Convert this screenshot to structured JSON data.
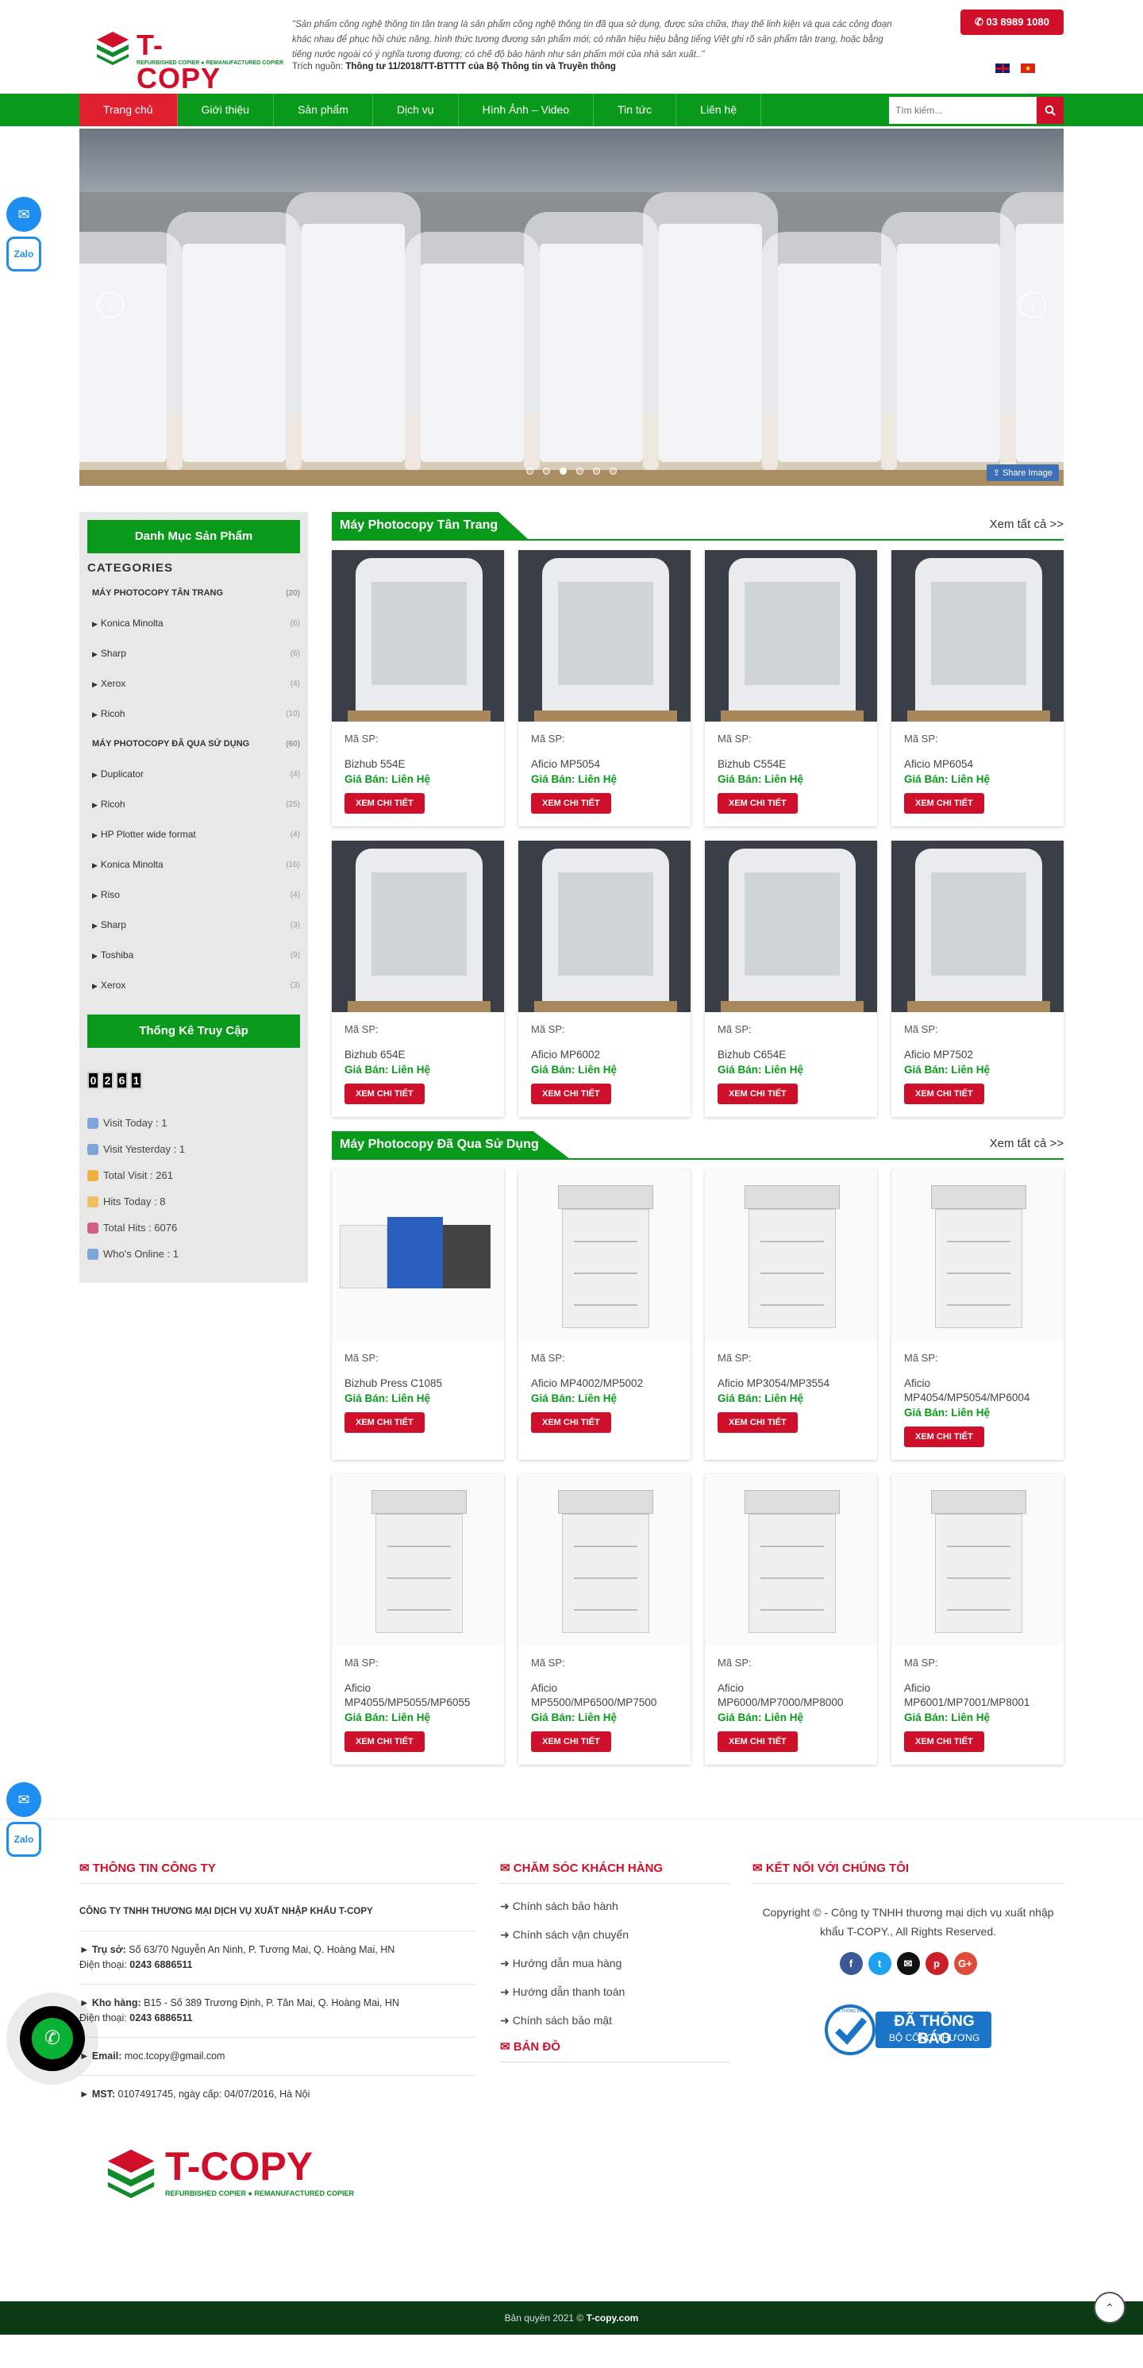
{
  "header": {
    "logo_text": "T-COPY",
    "logo_tagline": "REFURBISHED COPIER ● REMANUFACTURED COPIER",
    "quote": "\"Sản phẩm công nghệ thông tin tân trang là sản phẩm công nghệ thông tin đã qua sử dụng, được sửa chữa, thay thế linh kiện và qua các công đoạn khác nhau để phục hồi chức năng, hình thức tương đương sản phẩm mới; có nhãn hiệu hiệu bằng tiếng Việt ghi rõ sản phẩm tân trang, hoặc bằng tiếng nước ngoài có ý nghĩa tương đương; có chế độ bảo hành như sản phẩm mới của nhà sản xuất..\"",
    "source_label": "Trích nguồn:",
    "source_value": "Thông tư 11/2018/TT-BTTTT của Bộ Thông tin và Truyền thông",
    "hotline": "03 8989 1080"
  },
  "nav": {
    "items": [
      "Trang chủ",
      "Giới thiệu",
      "Sản phẩm",
      "Dịch vụ",
      "Hình Ảnh – Video",
      "Tin tức",
      "Liên hệ"
    ],
    "search_placeholder": "Tìm kiếm..."
  },
  "slider": {
    "share_label": "Share Image",
    "dot_count": 6,
    "active_dot": 3
  },
  "sidebar": {
    "category_title": "Danh Mục Sản Phẩm",
    "categories_head": "CATEGORIES",
    "categories": [
      {
        "label": "MÁY PHOTOCOPY TÂN TRANG",
        "count": "(20)",
        "top": true
      },
      {
        "label": "Konica Minolta",
        "count": "(6)"
      },
      {
        "label": "Sharp",
        "count": "(6)"
      },
      {
        "label": "Xerox",
        "count": "(4)"
      },
      {
        "label": "Ricoh",
        "count": "(10)"
      },
      {
        "label": "MÁY PHOTOCOPY ĐÃ QUA SỬ DỤNG",
        "count": "(60)",
        "top": true
      },
      {
        "label": "Duplicator",
        "count": "(4)"
      },
      {
        "label": "Ricoh",
        "count": "(25)"
      },
      {
        "label": "HP Plotter wide format",
        "count": "(4)"
      },
      {
        "label": "Konica Minolta",
        "count": "(16)"
      },
      {
        "label": "Riso",
        "count": "(4)"
      },
      {
        "label": "Sharp",
        "count": "(3)"
      },
      {
        "label": "Toshiba",
        "count": "(9)"
      },
      {
        "label": "Xerox",
        "count": "(3)"
      }
    ],
    "stats_title": "Thống Kê Truy Cập",
    "counter_digits": [
      "0",
      "2",
      "6",
      "1"
    ],
    "stats": [
      "Visit Today : 1",
      "Visit Yesterday : 1",
      "Total Visit : 261",
      "Hits Today : 8",
      "Total Hits : 6076",
      "Who's Online : 1"
    ]
  },
  "sections": [
    {
      "title": "Máy Photocopy Tân Trang",
      "see_all": "Xem tất cả >>",
      "products": [
        {
          "code_label": "Mã SP:",
          "name": "Bizhub 554E",
          "price": "Giá Bán: Liên Hệ",
          "button": "XEM CHI TIẾT"
        },
        {
          "code_label": "Mã SP:",
          "name": "Aficio MP5054",
          "price": "Giá Bán: Liên Hệ",
          "button": "XEM CHI TIẾT"
        },
        {
          "code_label": "Mã SP:",
          "name": "Bizhub C554E",
          "price": "Giá Bán: Liên Hệ",
          "button": "XEM CHI TIẾT"
        },
        {
          "code_label": "Mã SP:",
          "name": "Aficio MP6054",
          "price": "Giá Bán: Liên Hệ",
          "button": "XEM CHI TIẾT"
        },
        {
          "code_label": "Mã SP:",
          "name": "Bizhub 654E",
          "price": "Giá Bán: Liên Hệ",
          "button": "XEM CHI TIẾT"
        },
        {
          "code_label": "Mã SP:",
          "name": "Aficio MP6002",
          "price": "Giá Bán: Liên Hệ",
          "button": "XEM CHI TIẾT"
        },
        {
          "code_label": "Mã SP:",
          "name": "Bizhub C654E",
          "price": "Giá Bán: Liên Hệ",
          "button": "XEM CHI TIẾT"
        },
        {
          "code_label": "Mã SP:",
          "name": "Aficio MP7502",
          "price": "Giá Bán: Liên Hệ",
          "button": "XEM CHI TIẾT"
        }
      ]
    },
    {
      "title": "Máy Photocopy Đã Qua Sử Dụng",
      "see_all": "Xem tất cả >>",
      "products": [
        {
          "code_label": "Mã SP:",
          "name": "Bizhub Press C1085",
          "price": "Giá Bán: Liên Hệ",
          "button": "XEM CHI TIẾT"
        },
        {
          "code_label": "Mã SP:",
          "name": "Aficio MP4002/MP5002",
          "price": "Giá Bán: Liên Hệ",
          "button": "XEM CHI TIẾT"
        },
        {
          "code_label": "Mã SP:",
          "name": "Aficio MP3054/MP3554",
          "price": "Giá Bán: Liên Hệ",
          "button": "XEM CHI TIẾT"
        },
        {
          "code_label": "Mã SP:",
          "name": "Aficio MP4054/MP5054/MP6004",
          "price": "Giá Bán: Liên Hệ",
          "button": "XEM CHI TIẾT"
        },
        {
          "code_label": "Mã SP:",
          "name": "Aficio MP4055/MP5055/MP6055",
          "price": "Giá Bán: Liên Hệ",
          "button": "XEM CHI TIẾT"
        },
        {
          "code_label": "Mã SP:",
          "name": "Aficio MP5500/MP6500/MP7500",
          "price": "Giá Bán: Liên Hệ",
          "button": "XEM CHI TIẾT"
        },
        {
          "code_label": "Mã SP:",
          "name": "Aficio MP6000/MP7000/MP8000",
          "price": "Giá Bán: Liên Hệ",
          "button": "XEM CHI TIẾT"
        },
        {
          "code_label": "Mã SP:",
          "name": "Aficio MP6001/MP7001/MP8001",
          "price": "Giá Bán: Liên Hệ",
          "button": "XEM CHI TIẾT"
        }
      ]
    }
  ],
  "footer": {
    "company_title": "THÔNG TIN CÔNG TY",
    "company_name": "CÔNG TY TNHH THƯƠNG MẠI DỊCH VỤ XUẤT NHẬP KHẨU T-COPY",
    "office_label": "► Trụ sở:",
    "office_value": "Số 63/70 Nguyễn An Ninh, P. Tương Mai, Q. Hoàng Mai, HN",
    "office_phone_label": "Điện thoại:",
    "office_phone": "0243 6886511",
    "warehouse_label": "► Kho hàng:",
    "warehouse_value": "B15 - Số 389 Trương Định, P. Tân Mai, Q. Hoàng Mai, HN",
    "warehouse_phone_label": "Điện thoại:",
    "warehouse_phone": "0243 6886511",
    "email_label": "► Email:",
    "email_value": "moc.tcopy@gmail.com",
    "tax_label": "► MST:",
    "tax_value": "0107491745, ngày cấp: 04/07/2016, Hà Nội",
    "care_title": "CHĂM SÓC KHÁCH HÀNG",
    "care_links": [
      "Chính sách bảo hành",
      "Chính sách vận chuyển",
      "Hướng dẫn mua hàng",
      "Hướng dẫn thanh toán",
      "Chính sách bảo mật"
    ],
    "map_title": "BẢN ĐỒ",
    "connect_title": "KẾT NỐI VỚI CHÚNG TÔI",
    "copyright": "Copyright © - Công ty TNHH thương mại dịch vụ xuất nhập khẩu T-COPY., All Rights Reserved.",
    "badge_line1": "ĐÃ THÔNG BÁO",
    "badge_line2": "BỘ CÔNG THƯƠNG",
    "badge_seal_text": "ĐÃ THÔNG BÁO",
    "bottom_text": "Bản quyền 2021 ©",
    "bottom_brand": "T-copy.com"
  },
  "floating": {
    "zalo_label": "Zalo"
  },
  "colors": {
    "green": "#0a9a1b",
    "red": "#d0102a"
  }
}
